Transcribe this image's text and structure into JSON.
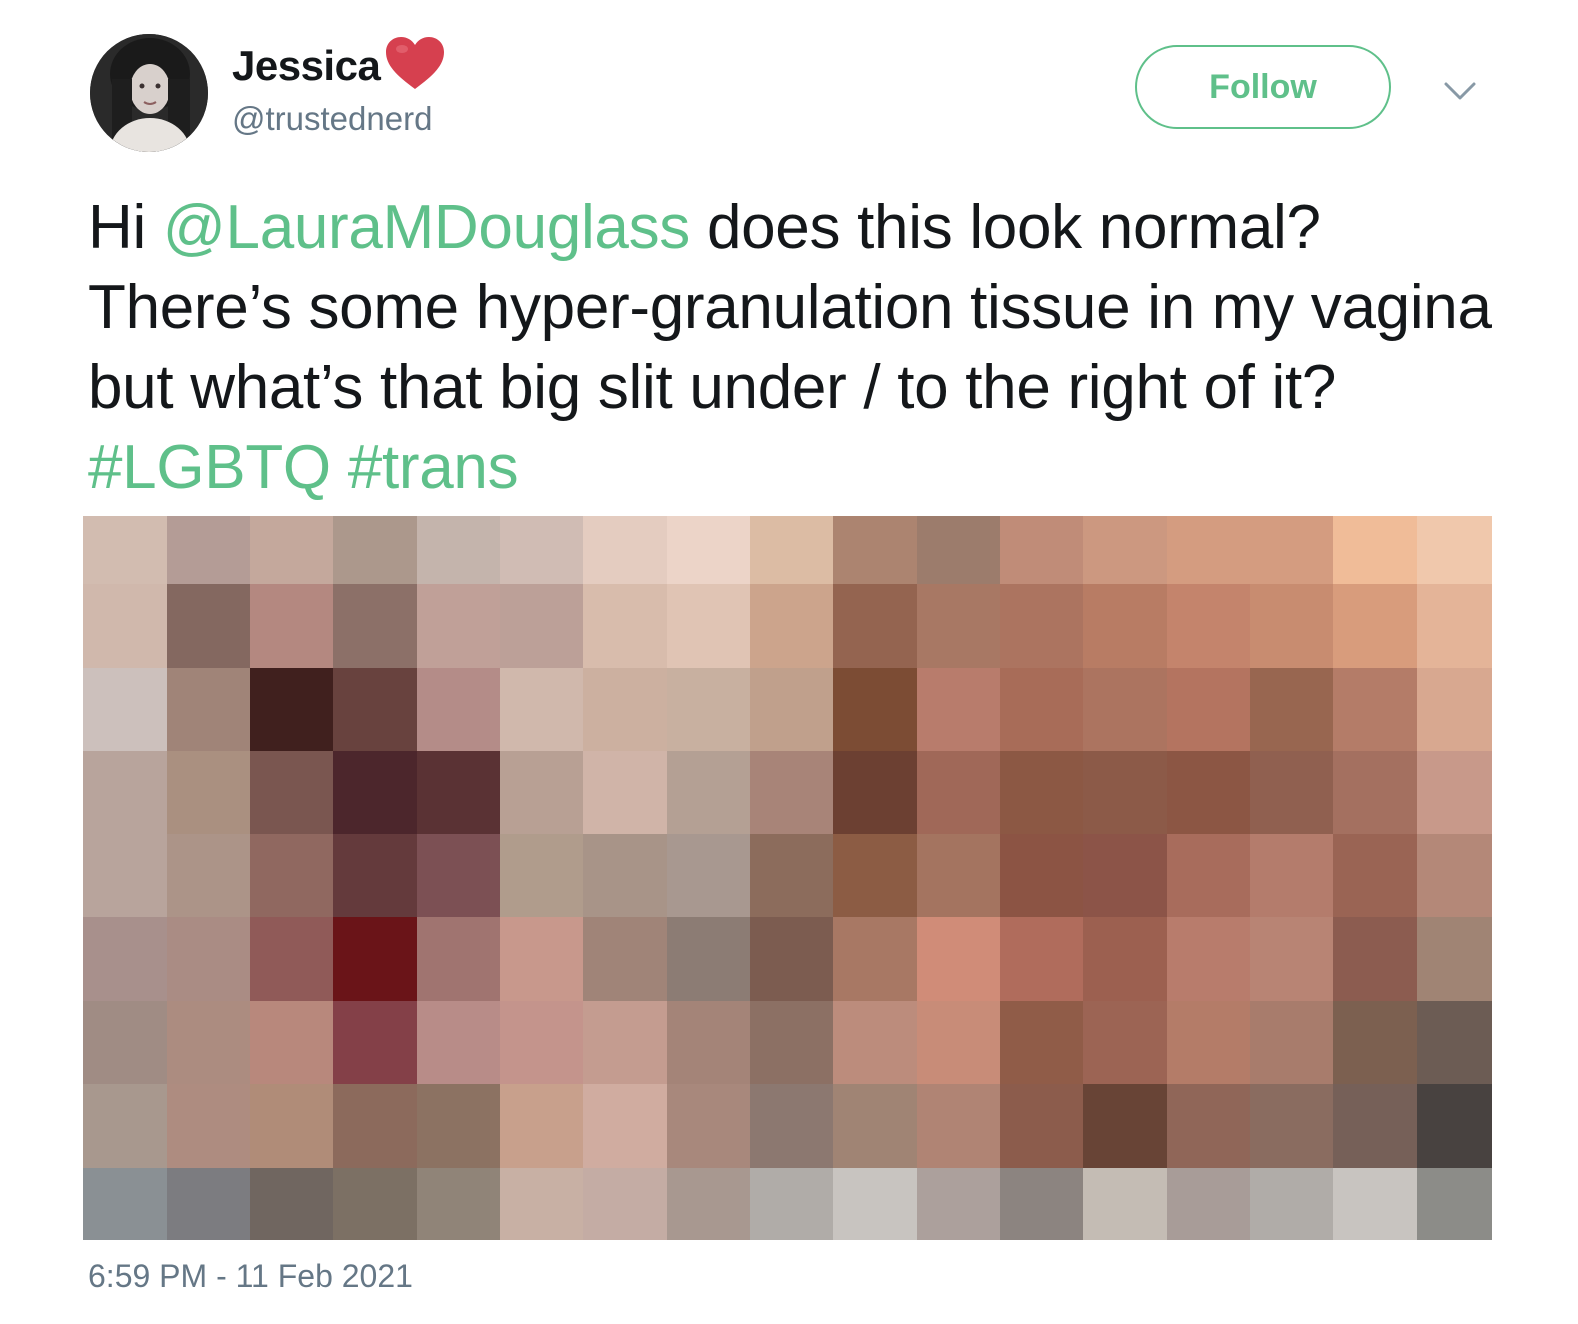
{
  "author": {
    "display_name": "Jessica",
    "handle": "@trustednerd",
    "badge_icon": "red-heart-emoji",
    "badge_color": "#d6404f"
  },
  "header": {
    "follow_label": "Follow",
    "menu_icon": "chevron-down-icon"
  },
  "tweet": {
    "segments": [
      {
        "text": "Hi ",
        "type": "text"
      },
      {
        "text": "@LauraMDouglass",
        "type": "mention"
      },
      {
        "text": " does this look normal? There’s some hyper-granulation tissue in my vagina but what’s that big slit under / to the right of it? ",
        "type": "text"
      },
      {
        "text": "#LGBTQ",
        "type": "hashtag"
      },
      {
        "text": " ",
        "type": "text"
      },
      {
        "text": "#trans",
        "type": "hashtag"
      }
    ],
    "timestamp": "6:59 PM - 11 Feb 2021"
  },
  "media": {
    "description_type": "pixelated-censored-image",
    "grid": [
      [
        "#d2bcb0",
        "#b49c96",
        "#c4a89c",
        "#ac988c",
        "#c4b4ac",
        "#d0bcb4",
        "#e4ccc0",
        "#ecd4c8",
        "#dcbca4",
        "#ac8470",
        "#9c7c6c",
        "#c08c78",
        "#cc9880",
        "#d49c80",
        "#d49c80",
        "#f0bc98",
        "#f0c8ac"
      ],
      [
        "#d0b8ac",
        "#846860",
        "#b48880",
        "#8c7068",
        "#c0a098",
        "#bca098",
        "#d8bcac",
        "#e0c4b4",
        "#cca48c",
        "#946450",
        "#a87864",
        "#ac7460",
        "#b87c64",
        "#c4846c",
        "#c88c70",
        "#d89c7c",
        "#e4b498"
      ],
      [
        "#ccc0bc",
        "#a08478",
        "#40201e",
        "#68423e",
        "#b48c88",
        "#d0b8ac",
        "#ccb0a0",
        "#c8b0a0",
        "#c0a08c",
        "#7c4c34",
        "#b87c6c",
        "#a86c58",
        "#ac7460",
        "#b47460",
        "#986650",
        "#b47c68",
        "#d8a890"
      ],
      [
        "#b8a49c",
        "#aa9080",
        "#7a5650",
        "#4c262c",
        "#5a3234",
        "#b8a094",
        "#d0b4a8",
        "#b4a094",
        "#a88478",
        "#6c4032",
        "#a06858",
        "#8c5844",
        "#8c5a48",
        "#8c5644",
        "#906050",
        "#a47060",
        "#c8998a"
      ],
      [
        "#b8a49c",
        "#ac9488",
        "#906860",
        "#643a3c",
        "#7c5054",
        "#b09c8c",
        "#a89488",
        "#a89890",
        "#8c6c5c",
        "#8c5c44",
        "#a47460",
        "#8c5444",
        "#8c5448",
        "#a86c5c",
        "#b47c6c",
        "#9a6454",
        "#b48878"
      ],
      [
        "#a8908c",
        "#aa8c84",
        "#905a58",
        "#6a1418",
        "#a07470",
        "#c8988c",
        "#a08478",
        "#8c7c74",
        "#7c5c50",
        "#a87864",
        "#d08c78",
        "#b06c5c",
        "#9c6050",
        "#b87c6c",
        "#b88474",
        "#8c5c50",
        "#a08474"
      ],
      [
        "#a08c84",
        "#ac8c80",
        "#b8887c",
        "#844048",
        "#b88c88",
        "#c4948c",
        "#c49c90",
        "#a48478",
        "#8c7064",
        "#bc8c7c",
        "#c88c78",
        "#905c48",
        "#9c6454",
        "#b47c68",
        "#a87c6c",
        "#7c6050",
        "#6c5c54"
      ],
      [
        "#a8988e",
        "#ae8c80",
        "#b08c78",
        "#8c6a5c",
        "#8c7262",
        "#c8a08c",
        "#d0aca0",
        "#a8887c",
        "#8c7870",
        "#a08474",
        "#b08474",
        "#8c5c4c",
        "#684436",
        "#906658",
        "#8a6c60",
        "#766058",
        "#484240"
      ],
      [
        "#8a9094",
        "#7c7c80",
        "#706660",
        "#7c7064",
        "#908478",
        "#c8b0a4",
        "#c4aca4",
        "#a89890",
        "#b0aca8",
        "#c8c4c0",
        "#aca09c",
        "#8c8480",
        "#c4bcb4",
        "#a89c98",
        "#b0aca8",
        "#c8c4c0",
        "#8c8c88"
      ]
    ]
  }
}
